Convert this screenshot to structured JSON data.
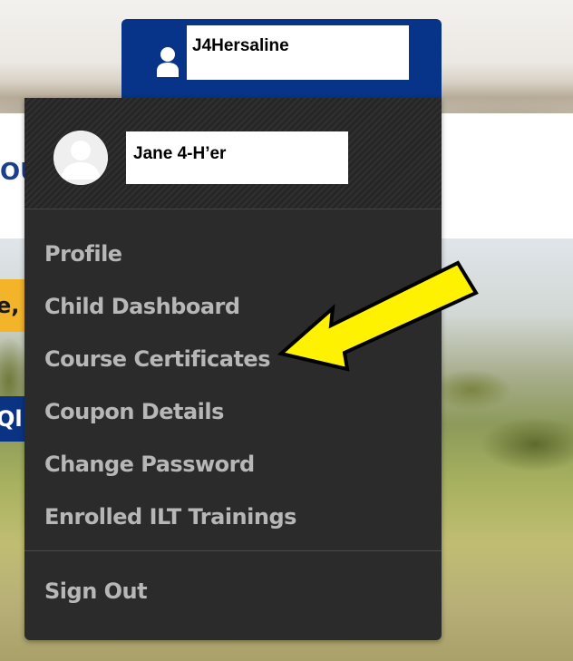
{
  "user_tab": {
    "username": "J4Hersaline",
    "icon": "user-icon"
  },
  "dropdown": {
    "display_name": "Jane 4-H’er",
    "avatar_icon": "avatar-placeholder",
    "items": [
      {
        "label": "Profile"
      },
      {
        "label": "Child Dashboard"
      },
      {
        "label": "Course Certificates"
      },
      {
        "label": "Coupon Details"
      },
      {
        "label": "Change Password"
      },
      {
        "label": "Enrolled ILT Trainings"
      }
    ],
    "sign_out": "Sign Out"
  },
  "annotation": {
    "arrow_icon": "arrow-icon",
    "color": "#fff200"
  },
  "colors": {
    "tab_blue": "#073488",
    "menu_bg": "#2b2b2b",
    "menu_text": "#b7b7b7"
  }
}
